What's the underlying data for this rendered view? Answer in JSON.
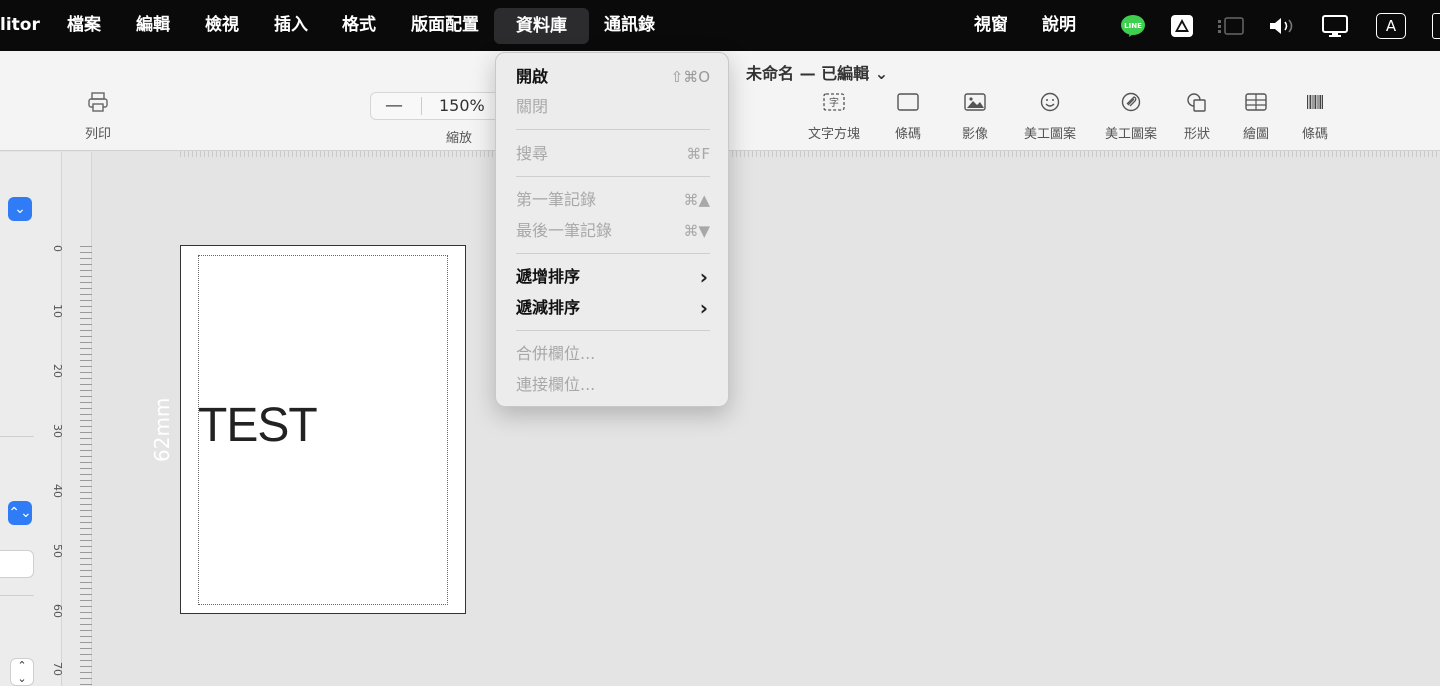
{
  "menubar": {
    "app": "litor",
    "items": [
      "檔案",
      "編輯",
      "檢視",
      "插入",
      "格式",
      "版面配置",
      "資料庫",
      "通訊錄"
    ],
    "right_items": [
      "視窗",
      "說明"
    ],
    "active": "資料庫",
    "status_icons": [
      "line-icon",
      "drive-icon",
      "stage-manager-icon",
      "volume-icon",
      "display-icon",
      "input-method-icon"
    ],
    "input_method": "A"
  },
  "toolbar": {
    "print_label": "列印",
    "zoom_minus": "—",
    "zoom_value": "150%",
    "zoom_label": "縮放",
    "doc_title": "未命名 — 已編輯",
    "tools": [
      {
        "icon": "text-box-icon",
        "glyph": "字",
        "label": "文字方塊"
      },
      {
        "icon": "barcode-rect-icon",
        "glyph": "",
        "label": "條碼"
      },
      {
        "icon": "image-icon",
        "glyph": "",
        "label": "影像"
      },
      {
        "icon": "smiley-icon",
        "glyph": "☺",
        "label": "美工圖案"
      },
      {
        "icon": "clip-art-icon",
        "glyph": "⊘",
        "label": "美工圖案"
      },
      {
        "icon": "shape-icon",
        "glyph": "",
        "label": "形狀"
      },
      {
        "icon": "table-icon",
        "glyph": "",
        "label": "繪圖"
      },
      {
        "icon": "barcode-icon",
        "glyph": "||||||",
        "label": "條碼"
      }
    ]
  },
  "menu": {
    "items": [
      {
        "label": "開啟",
        "shortcut": "⇧⌘O",
        "enabled": true
      },
      {
        "label": "關閉",
        "shortcut": "",
        "enabled": false
      },
      {
        "label": "搜尋",
        "shortcut": "⌘F",
        "enabled": false
      },
      {
        "label": "第一筆記錄",
        "shortcut": "⌘▲",
        "enabled": false
      },
      {
        "label": "最後一筆記錄",
        "shortcut": "⌘▼",
        "enabled": false
      },
      {
        "label": "遞增排序",
        "shortcut": "",
        "enabled": true,
        "submenu": true
      },
      {
        "label": "遞減排序",
        "shortcut": "",
        "enabled": true,
        "submenu": true
      },
      {
        "label": "合併欄位...",
        "shortcut": "",
        "enabled": false
      },
      {
        "label": "連接欄位...",
        "shortcut": "",
        "enabled": false
      }
    ],
    "submenu_glyph": "›"
  },
  "ruler": {
    "numbers": [
      "0",
      "10",
      "20",
      "30",
      "40",
      "50",
      "60",
      "70"
    ]
  },
  "canvas": {
    "label_text": "TEST",
    "dimension": "62mm"
  },
  "sidebar": {
    "popup_glyph": "⌄",
    "stepper_glyph": "⌃⌄",
    "small_stepper_up": "⌃",
    "small_stepper_down": "⌄"
  }
}
